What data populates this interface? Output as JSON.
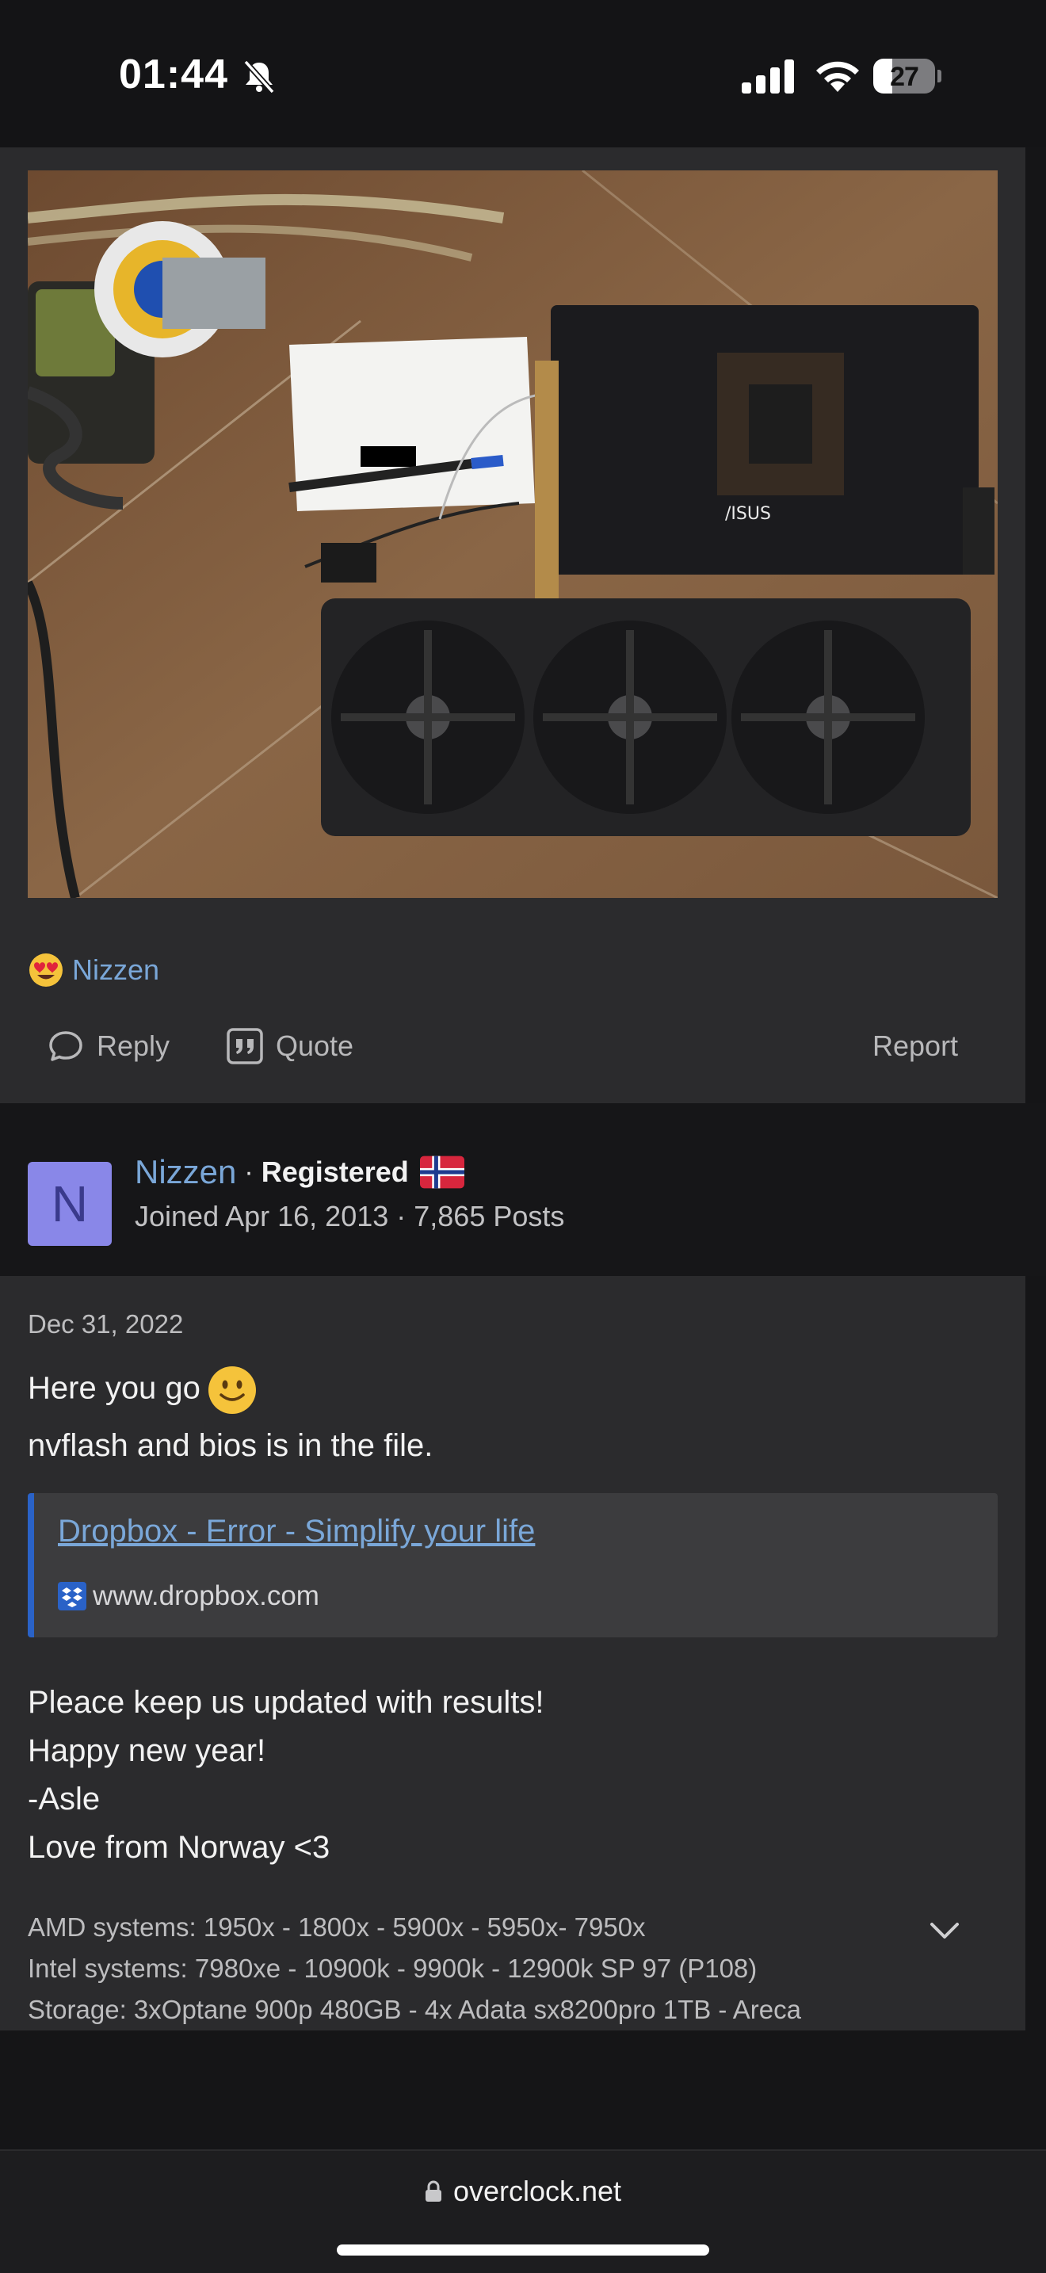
{
  "status_bar": {
    "time": "01:44",
    "battery": "27",
    "icons": [
      "bell-off-icon",
      "signal-icon",
      "wifi-icon",
      "battery-icon"
    ]
  },
  "post1": {
    "reaction": {
      "emoji": "heart-eyes-emoji",
      "user": "Nizzen"
    },
    "actions": {
      "reply": "Reply",
      "quote": "Quote",
      "report": "Report"
    }
  },
  "user": {
    "avatar_letter": "N",
    "name": "Nizzen",
    "separator": "·",
    "role": "Registered",
    "joined": "Joined Apr 16, 2013 · 7,865 Posts"
  },
  "post2": {
    "date": "Dec 31, 2022",
    "lines": [
      "Here you go",
      "nvflash and bios is in the file."
    ],
    "link": {
      "title": "Dropbox - Error - Simplify your life",
      "domain": "www.dropbox.com"
    },
    "closing": [
      "Pleace keep us updated with results!",
      "Happy new year!",
      "-Asle",
      "Love from Norway <3"
    ],
    "signature": [
      "AMD systems: 1950x - 1800x - 5900x - 5950x- 7950x",
      "Intel systems: 7980xe - 10900k - 9900k - 12900k SP 97 (P108)",
      "Storage: 3xOptane 900p 480GB - 4x Adata sx8200pro 1TB - Areca"
    ]
  },
  "browser": {
    "url": "overclock.net"
  },
  "colors": {
    "background": "#151517",
    "card": "#2b2b2d",
    "link": "#7aa7d8",
    "avatar": "#8987e8",
    "quote_bar": "#2a62c7"
  }
}
